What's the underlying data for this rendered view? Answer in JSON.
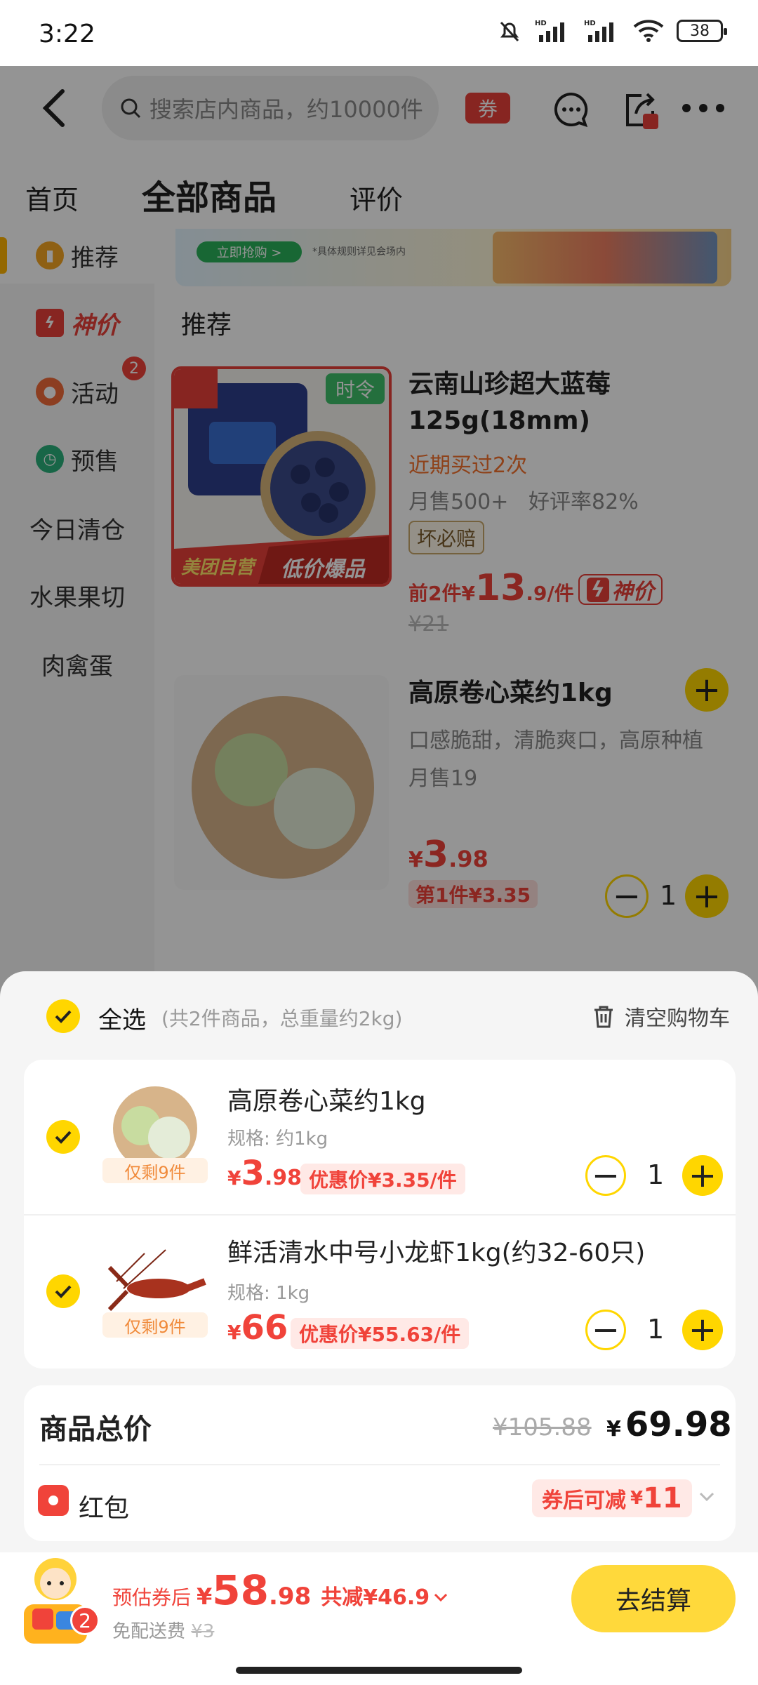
{
  "status": {
    "time": "3:22",
    "battery": "38"
  },
  "header": {
    "search_placeholder": "搜索店内商品，约10000件",
    "coupon_label": "券"
  },
  "tabs": [
    {
      "label": "首页"
    },
    {
      "label": "全部商品"
    },
    {
      "label": "评价"
    }
  ],
  "sidebar": {
    "items": [
      {
        "label": "推荐"
      },
      {
        "label": "神价"
      },
      {
        "label": "活动",
        "badge": "2"
      },
      {
        "label": "预售"
      },
      {
        "label": "今日清仓"
      },
      {
        "label": "水果果切"
      },
      {
        "label": "肉禽蛋"
      }
    ]
  },
  "banner": {
    "button": "立即抢购 >",
    "note": "*具体规则详见会场内"
  },
  "section_title": "推荐",
  "products": [
    {
      "name": "云南山珍超大蓝莓125g(18mm)",
      "tag_time": "时令",
      "img_banner_left": "美团自营",
      "img_banner_right": "低价爆品",
      "repurchase": "近期买过2次",
      "sales": "月售500+",
      "rating": "好评率82%",
      "guarantee": "坏必赔",
      "price_prefix": "前2件¥",
      "price_int": "13",
      "price_dec": ".9/件",
      "flash_label": "神价",
      "orig_price": "¥21"
    },
    {
      "name": "高原卷心菜约1kg",
      "desc": "口感脆甜，清脆爽口，高原种植",
      "sales": "月售19",
      "price_int": "3",
      "price_dec": ".98",
      "first_price": "第1件¥3.35",
      "qty": "1"
    }
  ],
  "cart": {
    "select_all": "全选",
    "summary": "(共2件商品，总重量约2kg)",
    "clear": "清空购物车",
    "items": [
      {
        "name": "高原卷心菜约1kg",
        "spec": "规格: 约1kg",
        "remain": "仅剩9件",
        "price_int": "3",
        "price_dec": ".98",
        "discount": "优惠价¥3.35/件",
        "qty": "1"
      },
      {
        "name": "鲜活清水中号小龙虾1kg(约32-60只)",
        "spec": "规格: 1kg",
        "remain": "仅剩9件",
        "price_int": "66",
        "price_dec": "",
        "discount": "优惠价¥55.63/件",
        "qty": "1"
      }
    ]
  },
  "total": {
    "label": "商品总价",
    "original": "¥105.88",
    "current": "69.98",
    "redpacket_label": "红包",
    "redpacket_value_prefix": "券后可减",
    "redpacket_value": "11"
  },
  "footer": {
    "est_label": "预估券后",
    "est_int": "58",
    "est_dec": ".98",
    "saved": "共减¥46.9",
    "free_label": "免配送费",
    "free_orig": "¥3",
    "badge": "2",
    "checkout": "去结算"
  },
  "colors": {
    "accent": "#ffd600",
    "price": "#f0433a",
    "orange": "#f5722d"
  }
}
